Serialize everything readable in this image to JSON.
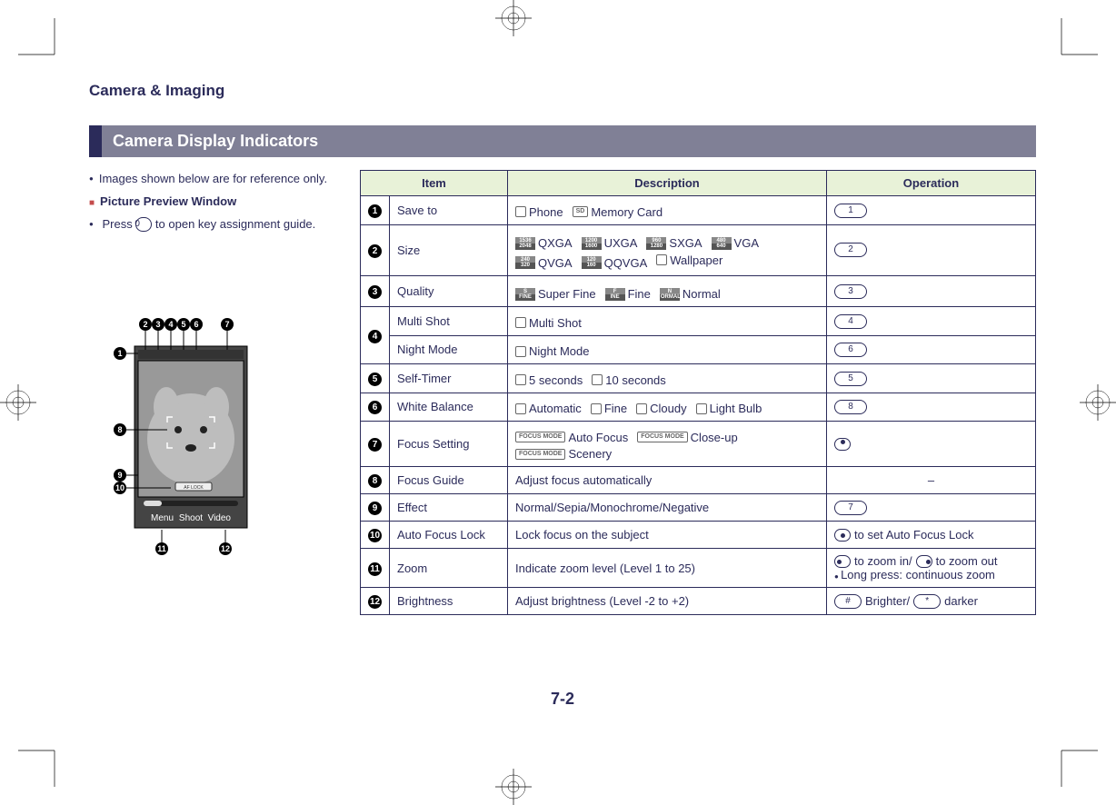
{
  "page": {
    "chapter_title": "Camera & Imaging",
    "section_title": "Camera Display Indicators",
    "page_number": "7-2"
  },
  "left": {
    "note_reference": "Images shown below are for reference only.",
    "subhead": "Picture Preview Window",
    "press_prefix": "Press ",
    "press_key": "0",
    "press_suffix": " to open key assignment guide.",
    "diagram_softkeys": {
      "left": "Menu",
      "center": "Shoot",
      "right": "Video"
    },
    "diagram_af_lock": "AF LOCK"
  },
  "table": {
    "headers": {
      "item": "Item",
      "description": "Description",
      "operation": "Operation"
    },
    "rows": [
      {
        "num": "1",
        "item": "Save to",
        "desc": [
          {
            "icon_label": "",
            "text": "Phone"
          },
          {
            "icon_label": "SD",
            "text": "Memory Card"
          }
        ],
        "op": {
          "type": "key",
          "value": "1"
        }
      },
      {
        "num": "2",
        "item": "Size",
        "desc": [
          {
            "icon_stack": [
              "1536",
              "2048"
            ],
            "text": "QXGA"
          },
          {
            "icon_stack": [
              "1200",
              "1600"
            ],
            "text": "UXGA"
          },
          {
            "icon_stack": [
              "960",
              "1280"
            ],
            "text": "SXGA"
          },
          {
            "icon_stack": [
              "480",
              "640"
            ],
            "text": "VGA"
          },
          {
            "icon_stack": [
              "240",
              "320"
            ],
            "text": "QVGA"
          },
          {
            "icon_stack": [
              "120",
              "160"
            ],
            "text": "QQVGA"
          },
          {
            "icon_label": "",
            "text": "Wallpaper"
          }
        ],
        "op": {
          "type": "key",
          "value": "2"
        }
      },
      {
        "num": "3",
        "item": "Quality",
        "desc": [
          {
            "icon_stack": [
              "S",
              "FINE"
            ],
            "text": "Super Fine"
          },
          {
            "icon_stack": [
              "F",
              "INE"
            ],
            "text": "Fine"
          },
          {
            "icon_stack": [
              "N",
              "ORMAL"
            ],
            "text": "Normal"
          }
        ],
        "op": {
          "type": "key",
          "value": "3"
        }
      },
      {
        "num": "4",
        "item": "Multi Shot",
        "desc": [
          {
            "icon_label": "",
            "text": "Multi Shot"
          }
        ],
        "op": {
          "type": "key",
          "value": "4"
        }
      },
      {
        "num": "",
        "item": "Night Mode",
        "desc": [
          {
            "icon_label": "",
            "text": "Night Mode"
          }
        ],
        "op": {
          "type": "key",
          "value": "6"
        }
      },
      {
        "num": "5",
        "item": "Self-Timer",
        "desc": [
          {
            "icon_label": "",
            "text": "5 seconds"
          },
          {
            "icon_label": "",
            "text": "10 seconds"
          }
        ],
        "op": {
          "type": "key",
          "value": "5"
        }
      },
      {
        "num": "6",
        "item": "White Balance",
        "desc": [
          {
            "icon_label": "",
            "text": "Automatic"
          },
          {
            "icon_label": "",
            "text": "Fine"
          },
          {
            "icon_label": "",
            "text": "Cloudy"
          },
          {
            "icon_label": "",
            "text": "Light Bulb"
          }
        ],
        "op": {
          "type": "key",
          "value": "8"
        }
      },
      {
        "num": "7",
        "item": "Focus Setting",
        "desc": [
          {
            "icon_label": "FOCUS MODE",
            "text": "Auto Focus"
          },
          {
            "icon_label": "FOCUS MODE",
            "text": "Close-up"
          },
          {
            "icon_label": "FOCUS MODE",
            "text": "Scenery"
          }
        ],
        "op": {
          "type": "arrow",
          "value": "up"
        }
      },
      {
        "num": "8",
        "item": "Focus Guide",
        "desc_text": "Adjust focus automatically",
        "op": {
          "type": "dash",
          "value": "–"
        }
      },
      {
        "num": "9",
        "item": "Effect",
        "desc_text": "Normal/Sepia/Monochrome/Negative",
        "op": {
          "type": "key",
          "value": "7"
        }
      },
      {
        "num": "10",
        "item": "Auto Focus Lock",
        "desc_text": "Lock focus on the subject",
        "op": {
          "type": "text_with_arrow",
          "arrow": "center",
          "suffix": " to set Auto Focus Lock"
        }
      },
      {
        "num": "11",
        "item": "Zoom",
        "desc_text": "Indicate zoom level (Level 1 to 25)",
        "op": {
          "type": "zoom",
          "in_arrow": "left",
          "in_text": " to zoom in/",
          "out_arrow": "right",
          "out_text": " to zoom out",
          "bullet": "Long press: continuous zoom"
        }
      },
      {
        "num": "12",
        "item": "Brightness",
        "desc_text": "Adjust brightness (Level -2 to +2)",
        "op": {
          "type": "brightness",
          "bright_key": "#",
          "bright_text": " Brighter/",
          "dark_key": "*",
          "dark_text": " darker"
        }
      }
    ]
  }
}
